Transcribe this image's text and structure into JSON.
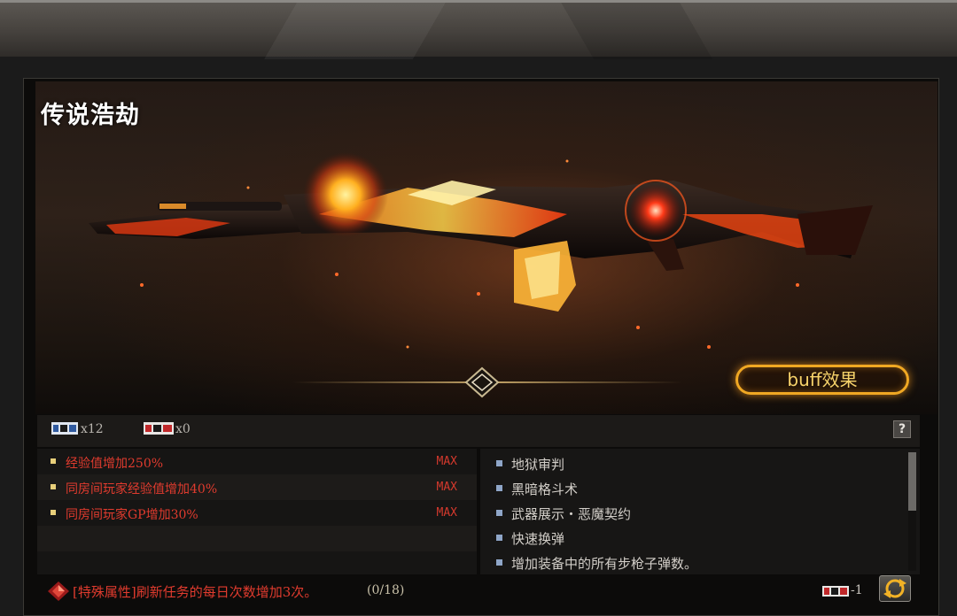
{
  "hero": {
    "title": "传说浩劫",
    "buff_label": "buff效果"
  },
  "tickets": {
    "blue_count": "x12",
    "red_count": "x0"
  },
  "help_label": "?",
  "attributes": [
    {
      "label": "经验值增加250%",
      "level": "MAX"
    },
    {
      "label": "同房间玩家经验值增加40%",
      "level": "MAX"
    },
    {
      "label": "同房间玩家GP增加30%",
      "level": "MAX"
    }
  ],
  "skills": [
    "地狱审判",
    "黑暗格斗术",
    "武器展示・恶魔契约",
    "快速换弹",
    "增加装备中的所有步枪子弹数。"
  ],
  "footer": {
    "special_attribute": "[特殊属性]刷新任务的每日次数增加3次。",
    "progress": "(0/18)",
    "refresh_cost": "-1"
  },
  "colors": {
    "attribute_red": "#e03b2e",
    "buff_gold": "#f0a823",
    "skill_bullet": "#8fa6c8"
  }
}
